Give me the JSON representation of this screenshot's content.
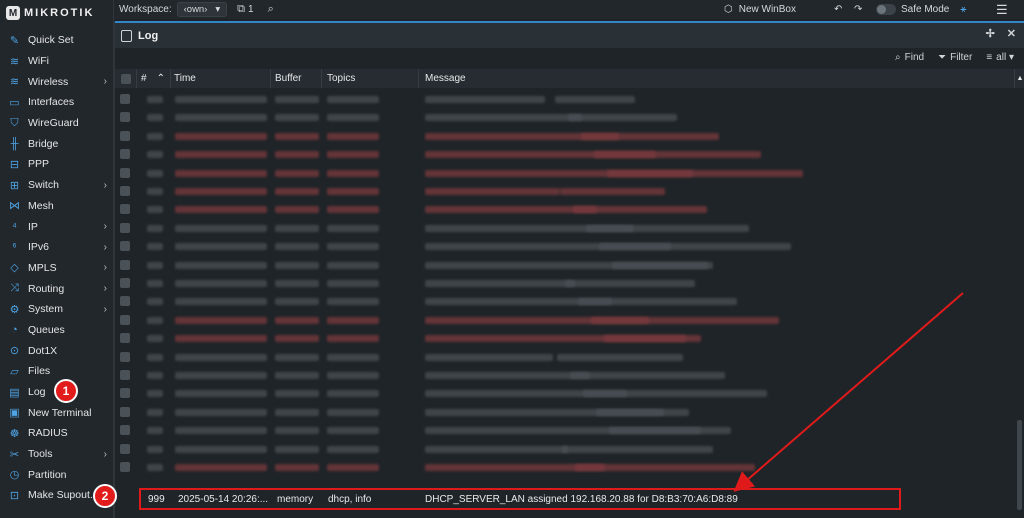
{
  "brand": {
    "logo_text": "MIKROTIK",
    "logo_mark": "M"
  },
  "sidebar": {
    "items": [
      {
        "label": "Quick Set",
        "icon": "quickset-icon",
        "glyph": "✎",
        "submenu": false
      },
      {
        "label": "WiFi",
        "icon": "wifi-icon",
        "glyph": "≋",
        "submenu": false
      },
      {
        "label": "Wireless",
        "icon": "wireless-icon",
        "glyph": "≋",
        "submenu": true
      },
      {
        "label": "Interfaces",
        "icon": "interfaces-icon",
        "glyph": "▭",
        "submenu": false
      },
      {
        "label": "WireGuard",
        "icon": "wireguard-icon",
        "glyph": "⛉",
        "submenu": false
      },
      {
        "label": "Bridge",
        "icon": "bridge-icon",
        "glyph": "╫",
        "submenu": false
      },
      {
        "label": "PPP",
        "icon": "ppp-icon",
        "glyph": "⊟",
        "submenu": false
      },
      {
        "label": "Switch",
        "icon": "switch-icon",
        "glyph": "⊞",
        "submenu": true
      },
      {
        "label": "Mesh",
        "icon": "mesh-icon",
        "glyph": "⋈",
        "submenu": false
      },
      {
        "label": "IP",
        "icon": "ip-icon",
        "glyph": "⁴",
        "submenu": true
      },
      {
        "label": "IPv6",
        "icon": "ipv6-icon",
        "glyph": "⁶",
        "submenu": true
      },
      {
        "label": "MPLS",
        "icon": "mpls-icon",
        "glyph": "◇",
        "submenu": true
      },
      {
        "label": "Routing",
        "icon": "routing-icon",
        "glyph": "⤨",
        "submenu": true
      },
      {
        "label": "System",
        "icon": "system-icon",
        "glyph": "⚙",
        "submenu": true
      },
      {
        "label": "Queues",
        "icon": "queues-icon",
        "glyph": "◔",
        "submenu": false
      },
      {
        "label": "Dot1X",
        "icon": "dot1x-icon",
        "glyph": "⊙",
        "submenu": false
      },
      {
        "label": "Files",
        "icon": "files-icon",
        "glyph": "▱",
        "submenu": false
      },
      {
        "label": "Log",
        "icon": "log-icon",
        "glyph": "▤",
        "submenu": false
      },
      {
        "label": "New Terminal",
        "icon": "terminal-icon",
        "glyph": "▣",
        "submenu": false
      },
      {
        "label": "RADIUS",
        "icon": "radius-icon",
        "glyph": "☸",
        "submenu": false
      },
      {
        "label": "Tools",
        "icon": "tools-icon",
        "glyph": "✂",
        "submenu": true
      },
      {
        "label": "Partition",
        "icon": "partition-icon",
        "glyph": "◷",
        "submenu": false
      },
      {
        "label": "Make Supout.rif",
        "icon": "supout-icon",
        "glyph": "⊡",
        "submenu": false
      }
    ]
  },
  "topbar": {
    "workspace_label": "Workspace:",
    "workspace_value": "‹own›",
    "workspace_count": "1",
    "new_winbox": "New WinBox",
    "safe_mode": "Safe Mode"
  },
  "log_window": {
    "title": "Log",
    "find": "Find",
    "filter": "Filter",
    "filter_value": "all"
  },
  "table": {
    "columns": [
      "#",
      "Time",
      "Buffer",
      "Topics",
      "Message"
    ],
    "last_row": {
      "number": "999",
      "time": "2025-05-14 20:26:...",
      "buffer": "memory",
      "topics": "dhcp, info",
      "message": "DHCP_SERVER_LAN assigned 192.168.20.88 for D8:B3:70:A6:D8:89"
    }
  },
  "annotations": {
    "badge_1": "1",
    "badge_2": "2"
  },
  "colors": {
    "accent": "#2f86c9",
    "highlight": "#e01a1a",
    "icon": "#4ea4e6"
  }
}
